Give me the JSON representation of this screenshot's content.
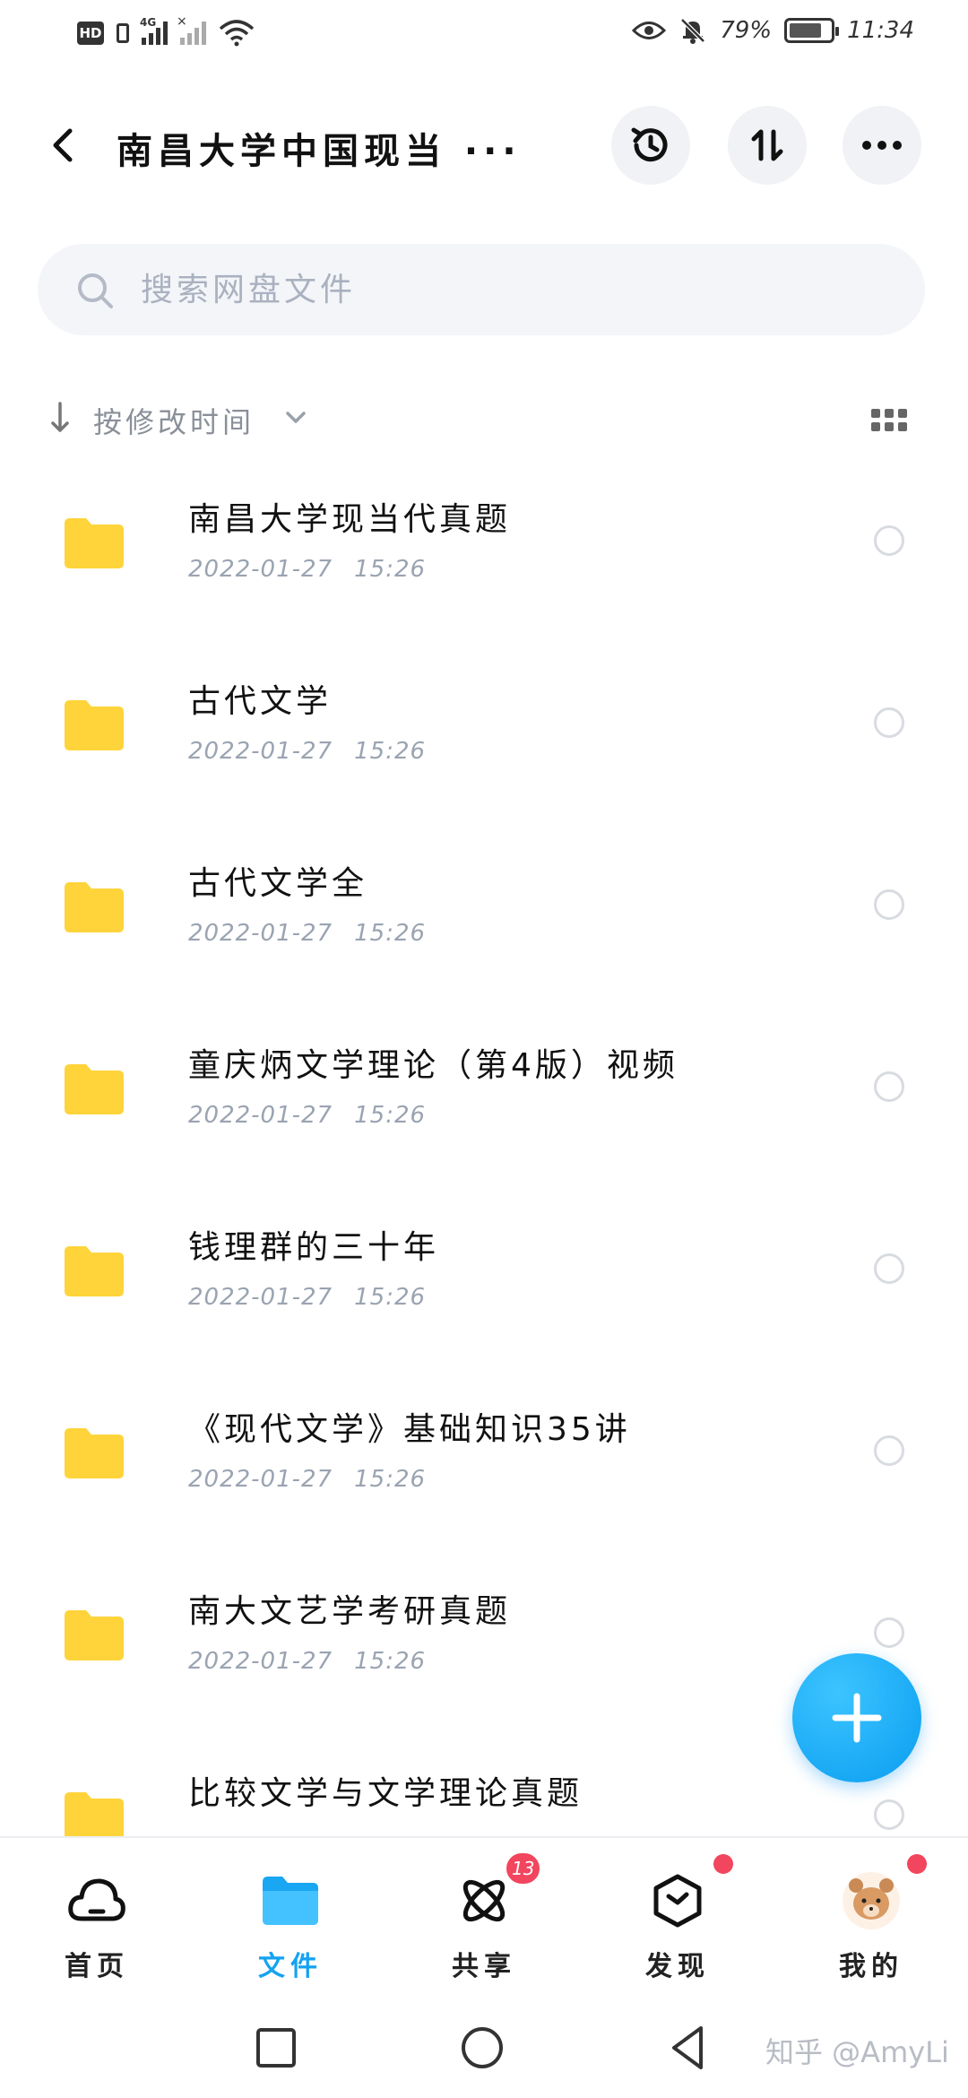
{
  "status_bar": {
    "hd": "HD",
    "network": "4G",
    "battery_percent": "79%",
    "battery_level": 0.79,
    "time": "11:34",
    "icons": [
      "eye-icon",
      "mute-bell-icon",
      "wifi-icon",
      "signal-icon"
    ]
  },
  "header": {
    "title": "南昌大学中国现当 ···",
    "buttons": [
      "history-icon",
      "sort-toggle-icon",
      "more-icon"
    ]
  },
  "search": {
    "placeholder": "搜索网盘文件"
  },
  "sort": {
    "label": "按修改时间"
  },
  "files": [
    {
      "name": "南昌大学现当代真题",
      "date": "2022-01-27",
      "time": "15:26"
    },
    {
      "name": "古代文学",
      "date": "2022-01-27",
      "time": "15:26"
    },
    {
      "name": "古代文学全",
      "date": "2022-01-27",
      "time": "15:26"
    },
    {
      "name": "童庆炳文学理论（第4版）视频",
      "date": "2022-01-27",
      "time": "15:26"
    },
    {
      "name": "钱理群的三十年",
      "date": "2022-01-27",
      "time": "15:26"
    },
    {
      "name": "《现代文学》基础知识35讲",
      "date": "2022-01-27",
      "time": "15:26"
    },
    {
      "name": "南大文艺学考研真题",
      "date": "2022-01-27",
      "time": "15:26"
    },
    {
      "name": "比较文学与文学理论真题",
      "date": "",
      "time": ""
    }
  ],
  "bottom_nav": [
    {
      "label": "首页",
      "icon": "cloud-icon"
    },
    {
      "label": "文件",
      "icon": "folder-icon",
      "active": true
    },
    {
      "label": "共享",
      "icon": "share-atom-icon",
      "badge": "13"
    },
    {
      "label": "发现",
      "icon": "discover-cube-icon",
      "dot": true
    },
    {
      "label": "我的",
      "icon": "bear-avatar-icon",
      "dot": true
    }
  ],
  "watermark": "知乎 @AmyLi",
  "colors": {
    "accent": "#13a3f0",
    "folder": "#ffd43b",
    "badge": "#f2455e"
  }
}
